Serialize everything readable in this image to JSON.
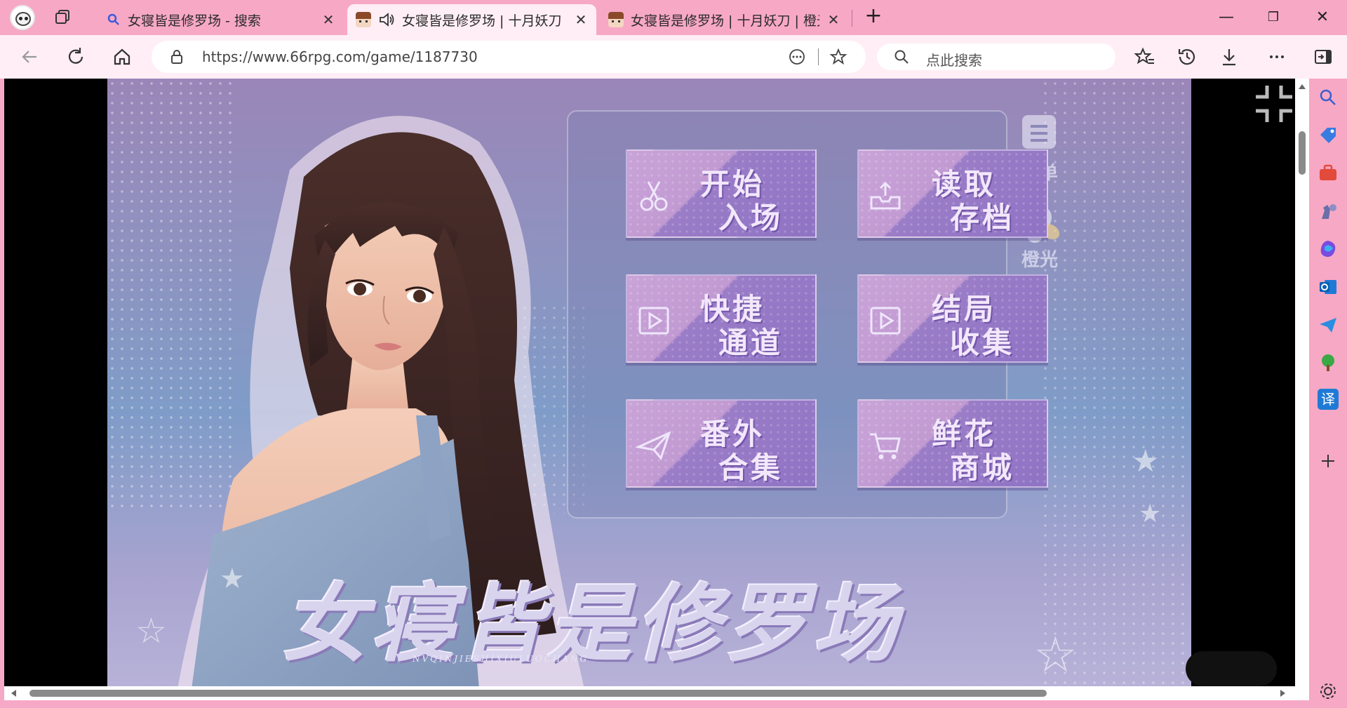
{
  "tabs": [
    {
      "title": "女寝皆是修罗场 - 搜索",
      "close": "✕"
    },
    {
      "title": "女寝皆是修罗场 | 十月妖刀 | ",
      "close": "✕"
    },
    {
      "title": "女寝皆是修罗场 | 十月妖刀 | 橙光",
      "close": "✕"
    }
  ],
  "newtab": "+",
  "window": {
    "minimize": "—",
    "restore": "❐",
    "close": "✕"
  },
  "address": {
    "url": "https://www.66rpg.com/game/1187730"
  },
  "search": {
    "placeholder": "点此搜索"
  },
  "game": {
    "menu": [
      {
        "line1": "开始",
        "line2": "入场",
        "icon": "scissors-icon"
      },
      {
        "line1": "读取",
        "line2": "存档",
        "icon": "inbox-icon"
      },
      {
        "line1": "快捷",
        "line2": "通道",
        "icon": "play-icon"
      },
      {
        "line1": "结局",
        "line2": "收集",
        "icon": "play-icon"
      },
      {
        "line1": "番外",
        "line2": "合集",
        "icon": "paper-plane-icon"
      },
      {
        "line1": "鲜花",
        "line2": "商城",
        "icon": "cart-icon"
      }
    ],
    "side": {
      "menu_label": "菜单",
      "brand_label": "橙光"
    },
    "logo_title": "女寝皆是修罗场",
    "logo_pinyin": "NVQINJIESHIXIULUOCHANG"
  },
  "colors": {
    "accent": "#f7a8c5",
    "toolbar": "#ffeef5",
    "button": "#9a7cc7"
  }
}
